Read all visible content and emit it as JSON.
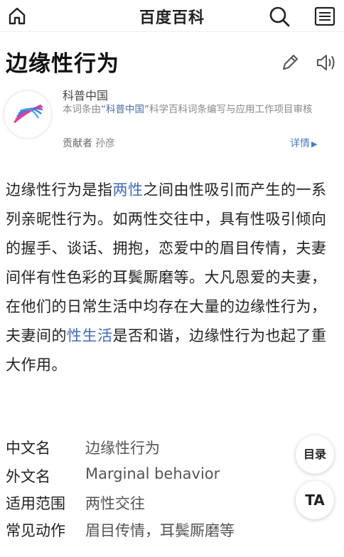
{
  "header": {
    "title": "百度百科",
    "icons": [
      "home-icon",
      "search-icon",
      "menu-icon"
    ]
  },
  "entry": {
    "title": "边缘性行为",
    "icons": [
      "edit-icon",
      "speaker-icon"
    ]
  },
  "source": {
    "name": "科普中国",
    "desc_prefix": "本词条由",
    "desc_highlight": "“科普中国”",
    "desc_suffix": "科学百科词条编写与应用工作项目审核",
    "contributor_label": "贡献者",
    "contributor_name": "孙彦",
    "details_label": "详情",
    "details_arrow": "▶",
    "logo_icon": "kepu-china-logo"
  },
  "body": {
    "seg1": "边缘性行为是指",
    "link1": "两性",
    "seg2": "之间由性吸引而产生的一系列亲昵性行为。如两性交往中，具有性吸引倾向的握手、谈话、拥抱，恋爱中的眉目传情，夫妻间伴有性色彩的耳鬓厮磨等。大凡恩爱的夫妻，在他们的日常生活中均存在大量的边缘性行为，夫妻间的",
    "link2": "性生活",
    "seg3": "是否和谐，边缘性行为也起了重大作用。"
  },
  "basic_info": [
    {
      "key": "中文名",
      "value": "边缘性行为"
    },
    {
      "key": "外文名",
      "value": "Marginal behavior"
    },
    {
      "key": "适用范围",
      "value": "两性交往"
    },
    {
      "key": "常见动作",
      "value": "眉目传情，耳鬓厮磨等"
    }
  ],
  "floating": {
    "toc_label": "目录",
    "font_label": "TA"
  },
  "colors": {
    "link": "#3f6cb8",
    "details": "#4a79c8",
    "muted": "#888888"
  }
}
